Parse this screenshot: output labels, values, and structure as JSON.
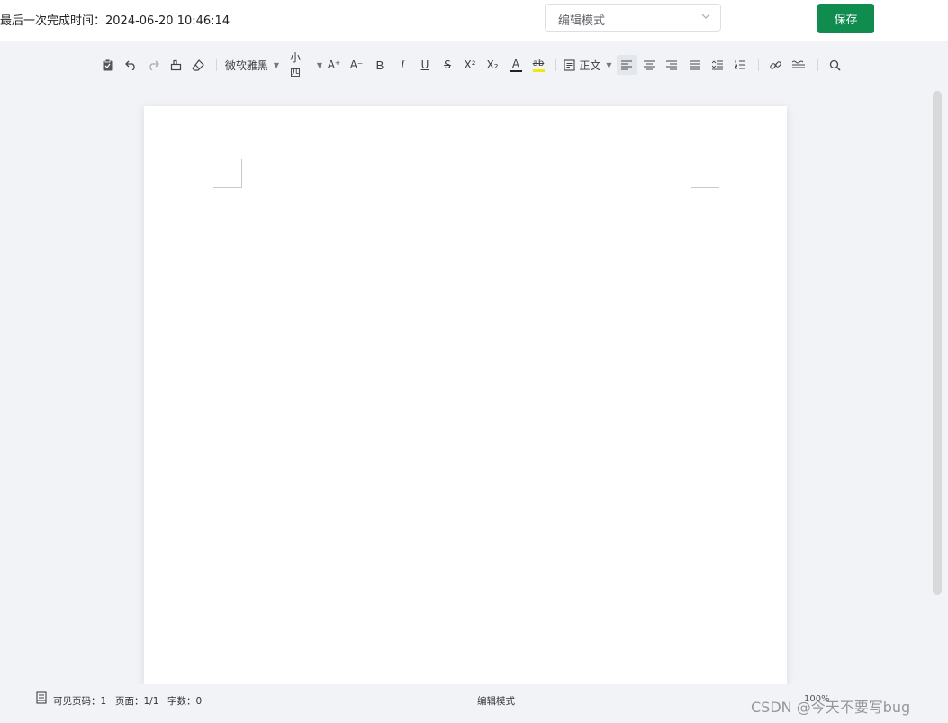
{
  "header": {
    "last_completed_label": "最后一次完成时间：",
    "last_completed_time": "2024-06-20 10:46:14",
    "mode_select_value": "编辑模式",
    "save_label": "保存"
  },
  "toolbar": {
    "font_family": "微软雅黑",
    "font_size": "小四",
    "paragraph_style": "正文",
    "superscript": "X²",
    "subscript": "X₂",
    "font_color_glyph": "A",
    "highlight_glyph": "ab",
    "bold_glyph": "B",
    "italic_glyph": "I",
    "underline_glyph": "U",
    "strike_glyph": "S",
    "font_size_increase_glyph": "A⁺",
    "font_size_decrease_glyph": "A⁻",
    "colors": {
      "font_color_bar": "#222222",
      "highlight_bar": "#f5e50f"
    }
  },
  "footer": {
    "visible_pages": "可见页码：1",
    "page": "页面：1/1",
    "word_count": "字数：0",
    "mode": "编辑模式",
    "zoom": "100%"
  },
  "watermark": "CSDN @今天不要写bug",
  "colors": {
    "accent": "#118c4f",
    "canvas": "#f2f3f7"
  }
}
